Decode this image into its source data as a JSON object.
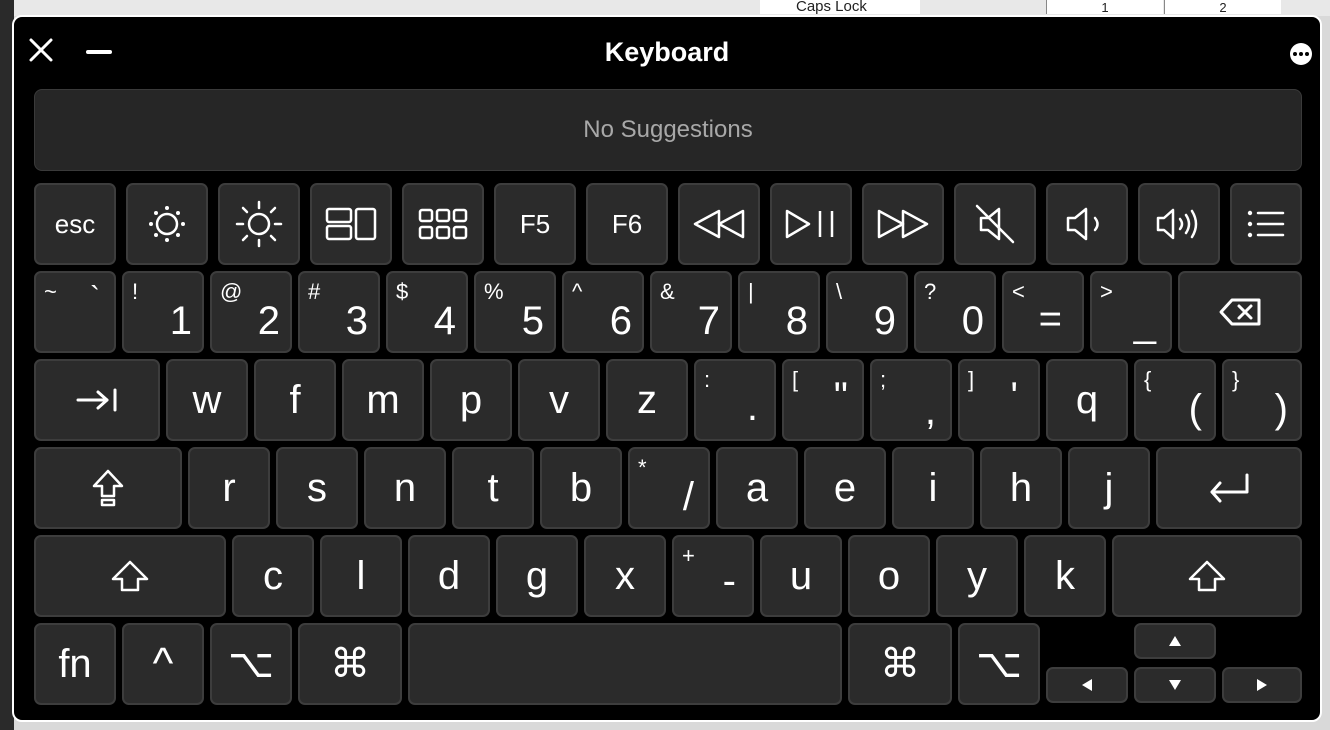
{
  "background": {
    "caps_lock_label": "Caps Lock",
    "cells": [
      "1",
      "2"
    ]
  },
  "window": {
    "title": "Keyboard"
  },
  "suggestions": {
    "text": "No Suggestions"
  },
  "keys": {
    "esc": "esc",
    "f5": "F5",
    "f6": "F6",
    "tilde": "~",
    "backtick": "`",
    "excl": "!",
    "one": "1",
    "at": "@",
    "two": "2",
    "hash": "#",
    "three": "3",
    "dollar": "$",
    "four": "4",
    "percent": "%",
    "five": "5",
    "caret": "^",
    "six": "6",
    "amp": "&",
    "seven": "7",
    "pipe": "|",
    "eight": "8",
    "backslash": "\\",
    "nine": "9",
    "question": "?",
    "zero": "0",
    "lt": "<",
    "equals": "=",
    "gt": ">",
    "underscore": "_",
    "w": "w",
    "f": "f",
    "m": "m",
    "p": "p",
    "v": "v",
    "z": "z",
    "colon": ":",
    "period": ".",
    "lbracket": "[",
    "dquote": "\"",
    "semicolon": ";",
    "comma": ",",
    "rbracket": "]",
    "squote": "'",
    "q": "q",
    "lbrace": "{",
    "lparen": "(",
    "rbrace": "}",
    "rparen": ")",
    "r": "r",
    "s": "s",
    "n": "n",
    "t": "t",
    "b": "b",
    "star": "*",
    "slash": "/",
    "a": "a",
    "e": "e",
    "i": "i",
    "h": "h",
    "j": "j",
    "c": "c",
    "l": "l",
    "d": "d",
    "g": "g",
    "x": "x",
    "plus": "+",
    "minus": "-",
    "u": "u",
    "o": "o",
    "y": "y",
    "k": "k",
    "fn": "fn",
    "control": "^",
    "option": "⌥",
    "command": "⌘"
  },
  "icons": [
    "close-icon",
    "minimize-icon",
    "more-options-icon",
    "brightness-down-icon",
    "brightness-up-icon",
    "mission-control-icon",
    "launchpad-icon",
    "rewind-icon",
    "play-pause-icon",
    "fast-forward-icon",
    "mute-icon",
    "volume-down-icon",
    "volume-up-icon",
    "list-icon",
    "delete-icon",
    "tab-icon",
    "caps-lock-icon",
    "return-icon",
    "shift-icon",
    "arrow-up-icon",
    "arrow-left-icon",
    "arrow-down-icon",
    "arrow-right-icon"
  ],
  "colors": {
    "window_bg": "#000000",
    "key_bg": "#2b2b2b",
    "key_border": "#3d3d3d",
    "text": "#ffffff",
    "suggest_text": "#a8a8a8"
  }
}
